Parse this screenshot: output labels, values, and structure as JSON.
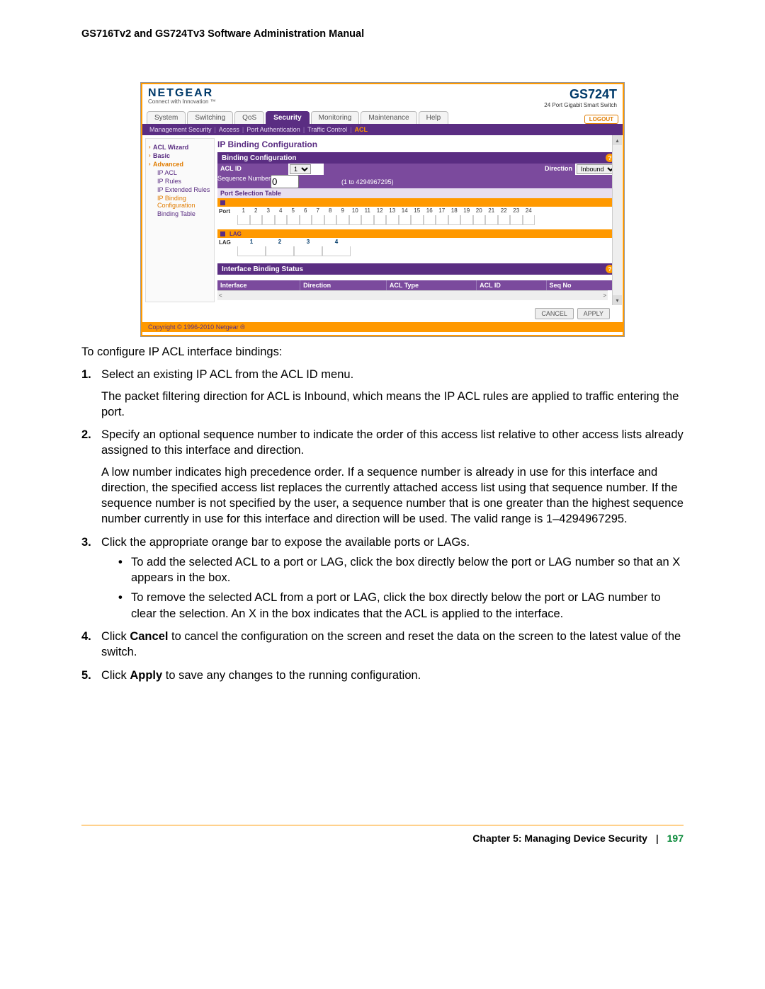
{
  "doc_header": "GS716Tv2 and GS724Tv3 Software Administration Manual",
  "screenshot": {
    "brand": "NETGEAR",
    "brand_tag": "Connect with Innovation ™",
    "model": "GS724T",
    "model_sub": "24 Port Gigabit Smart Switch",
    "tabs": [
      "System",
      "Switching",
      "QoS",
      "Security",
      "Monitoring",
      "Maintenance",
      "Help"
    ],
    "active_tab": "Security",
    "logout": "LOGOUT",
    "subnav": [
      "Management Security",
      "Access",
      "Port Authentication",
      "Traffic Control",
      "ACL"
    ],
    "subnav_active": "ACL",
    "sidebar": {
      "wizard": "ACL Wizard",
      "basic": "Basic",
      "advanced": "Advanced",
      "items": [
        "IP ACL",
        "IP Rules",
        "IP Extended Rules",
        "IP Binding Configuration",
        "Binding Table"
      ],
      "current": "IP Binding Configuration"
    },
    "pane_title": "IP Binding Configuration",
    "binding_cfg_hdr": "Binding Configuration",
    "acl_id_label": "ACL ID",
    "acl_id_value": "1",
    "direction_label": "Direction",
    "direction_value": "Inbound",
    "seq_label": "Sequence Number",
    "seq_value": "0",
    "seq_range": "(1 to 4294967295)",
    "port_sel_title": "Port Selection Table",
    "port_row_label": "Port",
    "lag_bar_label": "LAG",
    "lag_row_label": "LAG",
    "ports": [
      "1",
      "2",
      "3",
      "4",
      "5",
      "6",
      "7",
      "8",
      "9",
      "10",
      "11",
      "12",
      "13",
      "14",
      "15",
      "16",
      "17",
      "18",
      "19",
      "20",
      "21",
      "22",
      "23",
      "24"
    ],
    "lags": [
      "1",
      "2",
      "3",
      "4"
    ],
    "status_hdr": "Interface Binding Status",
    "status_cols": [
      "Interface",
      "Direction",
      "ACL Type",
      "ACL ID",
      "Seq No"
    ],
    "cancel": "CANCEL",
    "apply": "APPLY",
    "copyright": "Copyright © 1996-2010 Netgear ®"
  },
  "body": {
    "intro": "To configure IP ACL interface bindings:",
    "step1": "Select an existing IP ACL from the ACL ID menu.",
    "step1b": "The packet filtering direction for ACL is Inbound, which means the IP ACL rules are applied to traffic entering the port.",
    "step2": "Specify an optional sequence number to indicate the order of this access list relative to other access lists already assigned to this interface and direction.",
    "step2b": "A low number indicates high precedence order. If a sequence number is already in use for this interface and direction, the specified access list replaces the currently attached access list using that sequence number. If the sequence number is not specified by the user, a sequence number that is one greater than the highest sequence number currently in use for this interface and direction will be used. The valid range is 1–4294967295.",
    "step3": "Click the appropriate orange bar to expose the available ports or LAGs.",
    "step3a": "To add the selected ACL to a port or LAG, click the box directly below the port or LAG number so that an X appears in the box.",
    "step3b": "To remove the selected ACL from a port or LAG, click the box directly below the port or LAG number to clear the selection. An X in the box indicates that the ACL is applied to the interface.",
    "step4a": "Click ",
    "step4bold": "Cancel",
    "step4b": " to cancel the configuration on the screen and reset the data on the screen to the latest value of the switch.",
    "step5a": "Click ",
    "step5bold": "Apply",
    "step5b": " to save any changes to the running configuration."
  },
  "footer": {
    "chapter": "Chapter 5:  Managing Device Security",
    "page": "197"
  }
}
